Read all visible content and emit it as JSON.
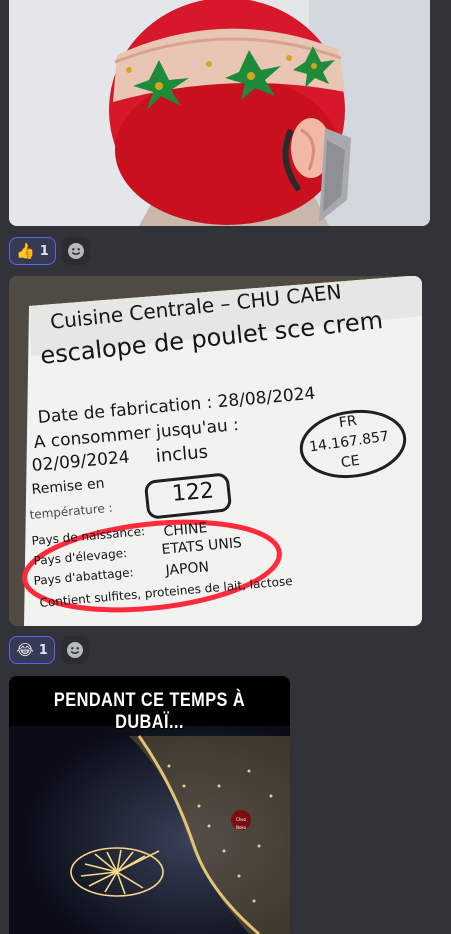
{
  "messages": [
    {
      "image": {
        "alt": ""
      },
      "reactions": [
        {
          "emoji": "👍",
          "count": "1"
        }
      ],
      "add_reaction_icon": "add-reaction-smiley-icon"
    },
    {
      "image": {
        "label": {
          "line1": "Cuisine Centrale – CHU CAEN",
          "line2": "escalope de poulet sce crem",
          "fab": "Date de fabrication : 28/08/2024",
          "consume": "A consommer jusqu'au :",
          "date": "02/09/2024",
          "inclus": "inclus",
          "remise": "Remise en",
          "remise_value": "122",
          "temperature": "température :",
          "stamp_line1": "FR",
          "stamp_line2": "14.167.857",
          "stamp_line3": "CE",
          "pays_naissance_label": "Pays de naissance:",
          "pays_naissance_value": "CHINE",
          "pays_elevage_label": "Pays d'élevage:",
          "pays_elevage_value": "ETATS UNIS",
          "pays_abattage_label": "Pays d'abattage:",
          "pays_abattage_value": "JAPON",
          "contient": "Contient sulfites, proteines de lait, lactose"
        }
      },
      "reactions": [
        {
          "emoji": "😂",
          "count": "1"
        }
      ],
      "add_reaction_icon": "add-reaction-smiley-icon"
    },
    {
      "image": {
        "caption": "PENDANT CE TEMPS À DUBAÏ...",
        "watermark": "Chez Noko"
      }
    }
  ],
  "colors": {
    "background": "#313338",
    "reaction_border": "#5865f2",
    "reaction_bg": "#373a54",
    "circle_annotation": "#ff2a3c"
  }
}
